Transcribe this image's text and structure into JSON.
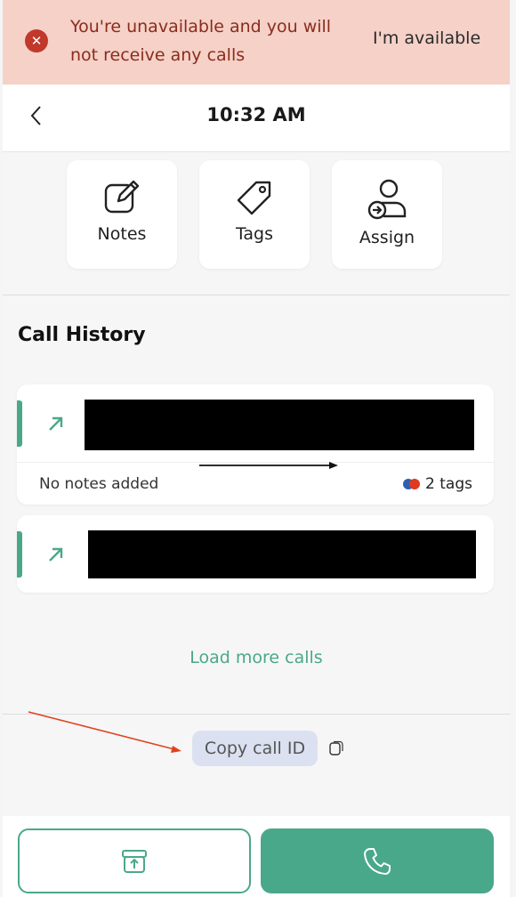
{
  "banner": {
    "message": "You're unavailable and you will not receive any calls",
    "action_label": "I'm available",
    "icon": "close-circle-icon",
    "color": "#c0392b"
  },
  "header": {
    "title": "10:32 AM",
    "back_icon": "chevron-left-icon"
  },
  "actions": [
    {
      "label": "Notes",
      "icon": "edit-note-icon"
    },
    {
      "label": "Tags",
      "icon": "tag-icon"
    },
    {
      "label": "Assign",
      "icon": "assign-user-icon"
    }
  ],
  "call_history": {
    "title": "Call History",
    "calls": [
      {
        "direction_icon": "outgoing-arrow-icon",
        "notes": "No notes added",
        "tags_label": "2 tags",
        "tag_colors": [
          "#2f5fb0",
          "#e03a1e"
        ]
      },
      {
        "direction_icon": "outgoing-arrow-icon"
      }
    ],
    "load_more_label": "Load more calls"
  },
  "copy_call_id": {
    "label": "Copy call ID",
    "icon": "copy-icon"
  },
  "bottom_bar": {
    "archive_icon": "archive-icon",
    "call_icon": "phone-icon"
  },
  "colors": {
    "accent": "#4aa88a",
    "banner_bg": "#f5d1c8",
    "banner_text": "#8a2c1c",
    "chip_bg": "#dbe1f0"
  }
}
